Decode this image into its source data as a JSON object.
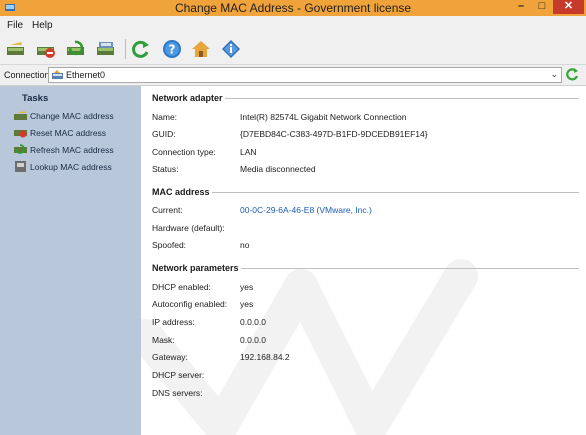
{
  "window": {
    "title": "Change MAC Address - Government license",
    "minimize": "–",
    "maximize": "□",
    "close": "✕"
  },
  "menu": [
    "File",
    "Help"
  ],
  "toolbar": {
    "icons": [
      "change-mac-icon",
      "reset-mac-icon",
      "refresh-mac-icon",
      "lookup-mac-icon",
      "refresh-icon",
      "help-icon",
      "home-icon",
      "info-icon"
    ]
  },
  "connection": {
    "label": "Connection:",
    "value": "Ethernet0",
    "arrow": "⌄"
  },
  "sidebar": {
    "title": "Tasks",
    "items": [
      {
        "label": "Change MAC address"
      },
      {
        "label": "Reset MAC address"
      },
      {
        "label": "Refresh MAC address"
      },
      {
        "label": "Lookup MAC address"
      }
    ]
  },
  "network_adapter": {
    "heading": "Network adapter",
    "rows": [
      {
        "key": "Name:",
        "value": "Intel(R) 82574L Gigabit Network Connection"
      },
      {
        "key": "GUID:",
        "value": "{D7EBD84C-C383-497D-B1FD-9DCEDB91EF14}"
      },
      {
        "key": "Connection type:",
        "value": "LAN"
      },
      {
        "key": "Status:",
        "value": "Media disconnected"
      }
    ]
  },
  "mac_address": {
    "heading": "MAC address",
    "rows": [
      {
        "key": "Current:",
        "value": "00-0C-29-6A-46-E8 (VMware, Inc.)"
      },
      {
        "key": "Hardware (default):",
        "value": ""
      },
      {
        "key": "Spoofed:",
        "value": "no"
      }
    ]
  },
  "network_parameters": {
    "heading": "Network parameters",
    "rows": [
      {
        "key": "DHCP enabled:",
        "value": "yes"
      },
      {
        "key": "Autoconfig enabled:",
        "value": "yes"
      },
      {
        "key": "IP address:",
        "value": "0.0.0.0"
      },
      {
        "key": "Mask:",
        "value": "0.0.0.0"
      },
      {
        "key": "Gateway:",
        "value": "192.168.84.2"
      },
      {
        "key": "DHCP server:",
        "value": ""
      },
      {
        "key": "DNS servers:",
        "value": ""
      }
    ]
  },
  "colors": {
    "titlebar": "#f0a33a",
    "sidebar": "#b8c8da",
    "link": "#1a5fb4",
    "close": "#c7392a"
  }
}
